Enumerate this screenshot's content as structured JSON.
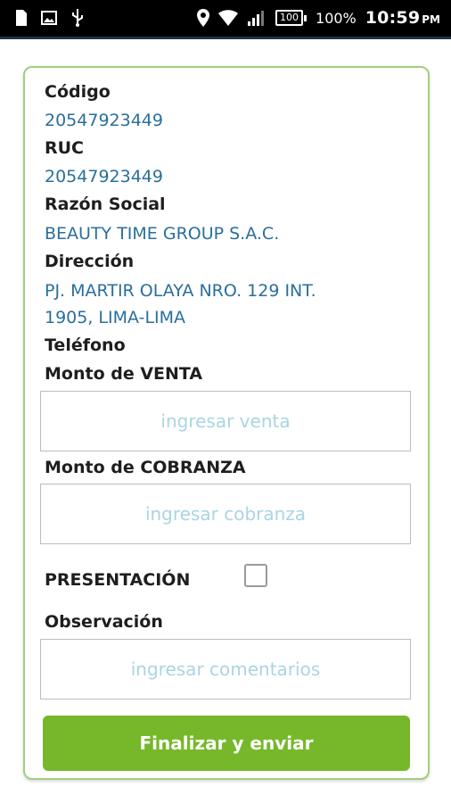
{
  "status_bar": {
    "battery_box": "100",
    "battery_percent": "100%",
    "time": "10:59",
    "ampm": "PM"
  },
  "form": {
    "codigo_label": "Código",
    "codigo_value": "20547923449",
    "ruc_label": "RUC",
    "ruc_value": "20547923449",
    "razon_label": "Razón Social",
    "razon_value": "BEAUTY TIME GROUP S.A.C.",
    "direccion_label": "Dirección",
    "direccion_line1": "PJ. MARTIR OLAYA NRO. 129 INT.",
    "direccion_line2": "1905, LIMA-LIMA",
    "telefono_label": "Teléfono",
    "venta_label": "Monto de VENTA",
    "venta_placeholder": "ingresar venta",
    "cobranza_label": "Monto de COBRANZA",
    "cobranza_placeholder": "ingresar cobranza",
    "presentacion_label": "PRESENTACIÓN",
    "presentacion_checked": false,
    "observacion_label": "Observación",
    "observacion_placeholder": "ingresar comentarios",
    "submit_label": "Finalizar y enviar"
  },
  "colors": {
    "accent_green": "#76b82a",
    "value_blue": "#2a6f9a",
    "placeholder_blue": "#a9d5e3"
  }
}
